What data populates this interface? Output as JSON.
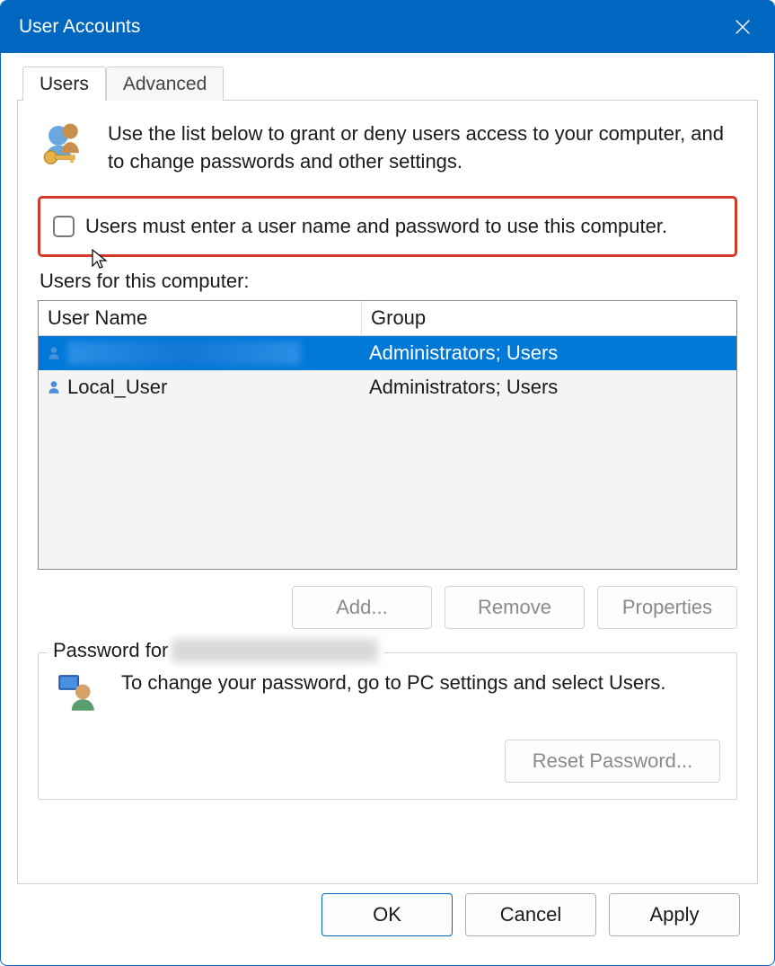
{
  "window": {
    "title": "User Accounts"
  },
  "tabs": [
    {
      "label": "Users",
      "active": true
    },
    {
      "label": "Advanced",
      "active": false
    }
  ],
  "intro": "Use the list below to grant or deny users access to your computer, and to change passwords and other settings.",
  "checkbox": {
    "label": "Users must enter a user name and password to use this computer.",
    "checked": false
  },
  "users_label": "Users for this computer:",
  "columns": {
    "name": "User Name",
    "group": "Group"
  },
  "rows": [
    {
      "name": "",
      "group": "Administrators; Users",
      "selected": true,
      "redacted": true
    },
    {
      "name": "Local_User",
      "group": "Administrators; Users",
      "selected": false,
      "redacted": false
    }
  ],
  "buttons": {
    "add": "Add...",
    "remove": "Remove",
    "properties": "Properties"
  },
  "password_section": {
    "legend_prefix": "Password for",
    "text": "To change your password, go to PC settings and select Users.",
    "reset": "Reset Password..."
  },
  "dialog_buttons": {
    "ok": "OK",
    "cancel": "Cancel",
    "apply": "Apply"
  }
}
